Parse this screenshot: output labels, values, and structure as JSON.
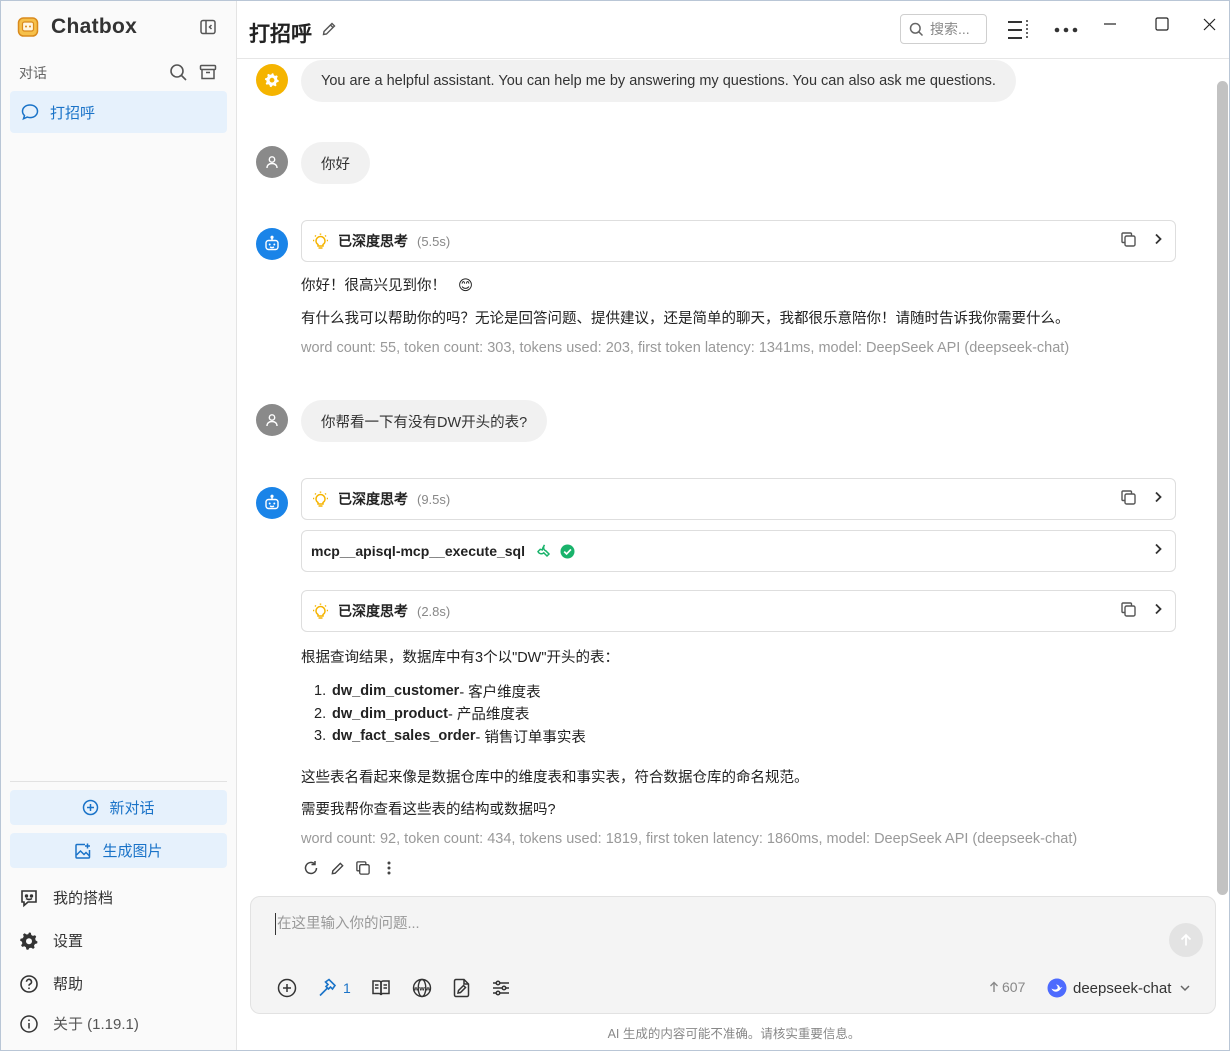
{
  "app": {
    "name": "Chatbox"
  },
  "sidebar": {
    "section_label": "对话",
    "sessions": [
      {
        "label": "打招呼"
      }
    ],
    "new_chat_label": "新对话",
    "gen_image_label": "生成图片",
    "menu": {
      "copilots": "我的搭档",
      "settings": "设置",
      "help": "帮助",
      "about": "关于 (1.19.1)"
    }
  },
  "header": {
    "title": "打招呼",
    "search_placeholder": "搜索..."
  },
  "messages": {
    "system_text": "You are a helpful assistant. You can help me by answering my questions. You can also ask me questions.",
    "user1_text": "你好",
    "bot1": {
      "think_label": "已深度思考",
      "think_duration": "(5.5s)",
      "line1": "你好！很高兴见到你！",
      "emoji": "😊",
      "line2": "有什么我可以帮助你的吗？无论是回答问题、提供建议，还是简单的聊天，我都很乐意陪你！请随时告诉我你需要什么。",
      "meta": "word count: 55, token count: 303, tokens used: 203, first token latency: 1341ms, model: DeepSeek API (deepseek-chat)"
    },
    "user2_text": "你帮看一下有没有DW开头的表?",
    "bot2": {
      "think1_label": "已深度思考",
      "think1_duration": "(9.5s)",
      "tool_name": "mcp__apisql-mcp__execute_sql",
      "think2_label": "已深度思考",
      "think2_duration": "(2.8s)",
      "intro": "根据查询结果，数据库中有3个以\"DW\"开头的表：",
      "tables": [
        {
          "num": "1.",
          "name": "dw_dim_customer",
          "desc": " - 客户维度表"
        },
        {
          "num": "2.",
          "name": "dw_dim_product",
          "desc": " - 产品维度表"
        },
        {
          "num": "3.",
          "name": "dw_fact_sales_order",
          "desc": " - 销售订单事实表"
        }
      ],
      "line3": "这些表名看起来像是数据仓库中的维度表和事实表，符合数据仓库的命名规范。",
      "line4": "需要我帮你查看这些表的结构或数据吗?",
      "meta": "word count: 92, token count: 434, tokens used: 1819, first token latency: 1860ms, model: DeepSeek API (deepseek-chat)"
    }
  },
  "composer": {
    "placeholder": "在这里输入你的问题...",
    "tool_count": "1",
    "token_estimate": "607",
    "model_name": "deepseek-chat"
  },
  "footer": {
    "disclaimer": "AI 生成的内容可能不准确。请核实重要信息。"
  },
  "colors": {
    "accent": "#1a73c8",
    "accent_bg": "#e6f1fc",
    "bot_avatar": "#1a84e8",
    "system_avatar": "#f5b400",
    "user_avatar": "#8a8a8a",
    "success": "#19b36b",
    "think_icon": "#f5b400"
  }
}
